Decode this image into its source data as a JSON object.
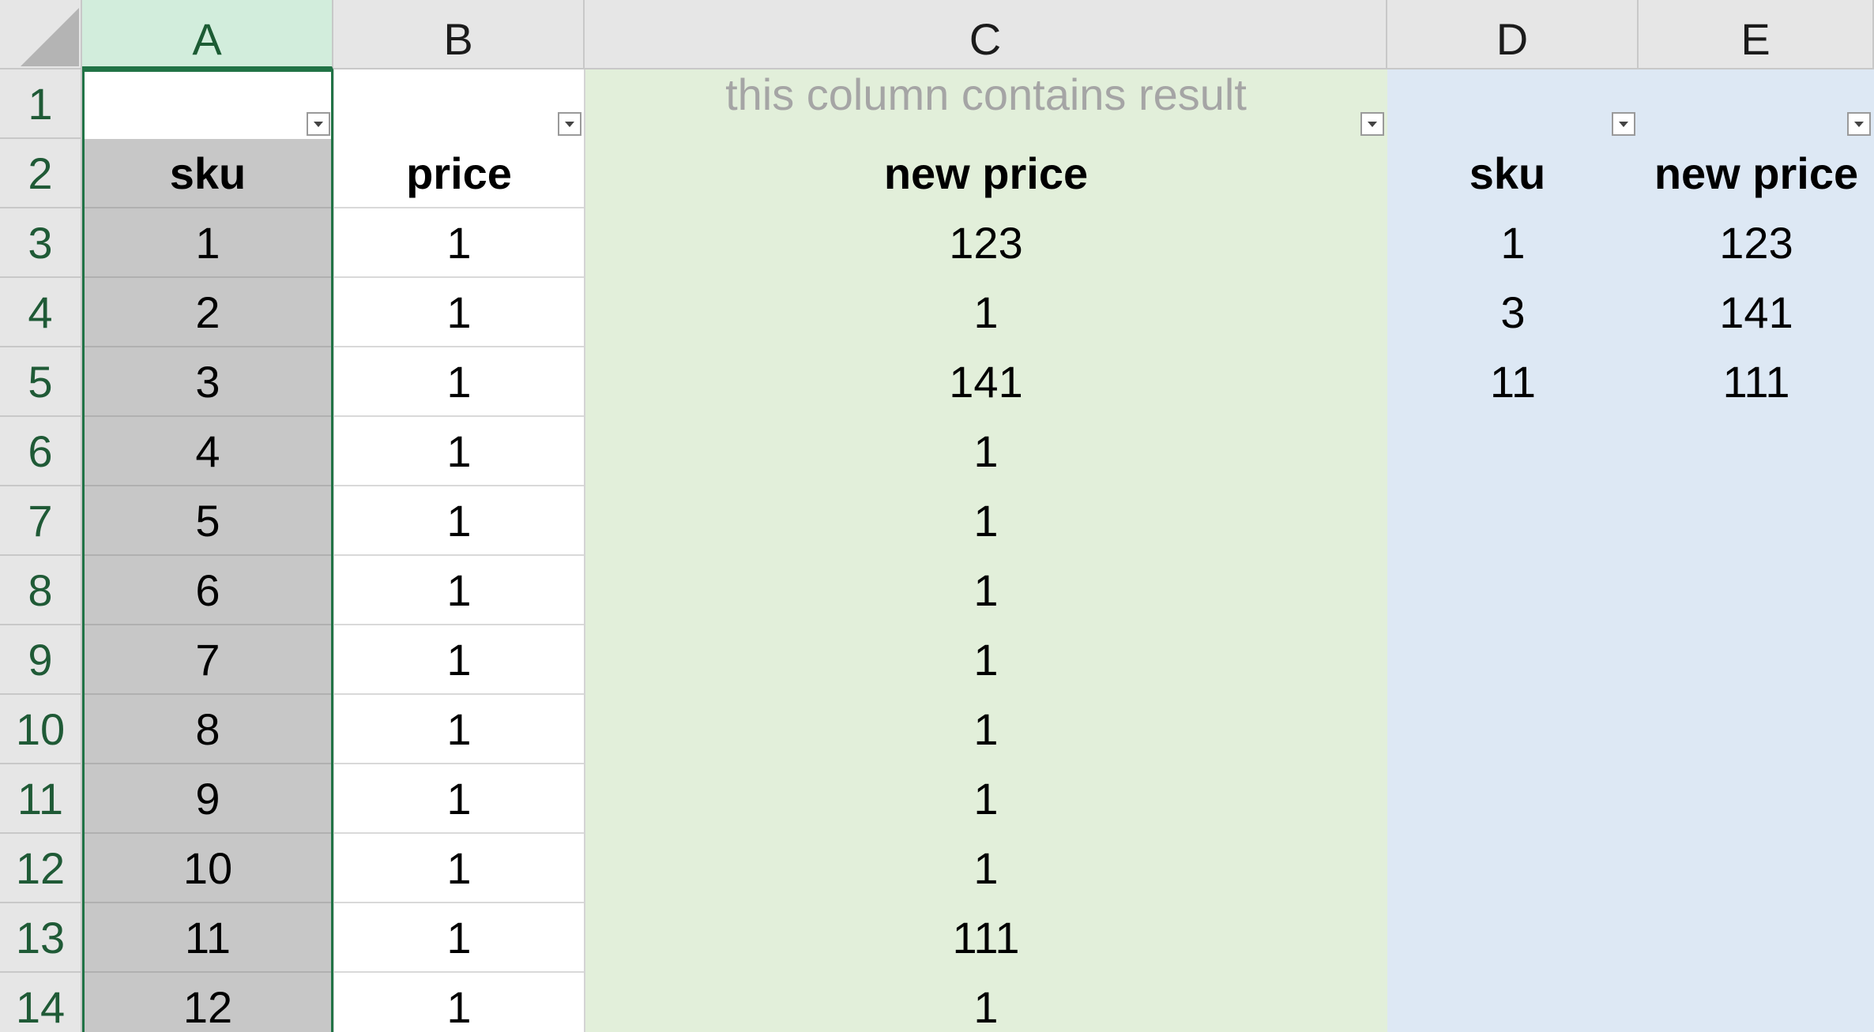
{
  "columns": [
    "A",
    "B",
    "C",
    "D",
    "E"
  ],
  "rows": [
    "1",
    "2",
    "3",
    "4",
    "5",
    "6",
    "7",
    "8",
    "9",
    "10",
    "11",
    "12",
    "13",
    "14"
  ],
  "row1": {
    "C": "this column contains result"
  },
  "headers": {
    "A": "sku",
    "B": "price",
    "C": "new price",
    "D": "sku",
    "E": "new price"
  },
  "data": [
    {
      "A": "1",
      "B": "1",
      "C": "123",
      "D": "1",
      "E": "123"
    },
    {
      "A": "2",
      "B": "1",
      "C": "1",
      "D": "3",
      "E": "141"
    },
    {
      "A": "3",
      "B": "1",
      "C": "141",
      "D": "11",
      "E": "111"
    },
    {
      "A": "4",
      "B": "1",
      "C": "1",
      "D": "",
      "E": ""
    },
    {
      "A": "5",
      "B": "1",
      "C": "1",
      "D": "",
      "E": ""
    },
    {
      "A": "6",
      "B": "1",
      "C": "1",
      "D": "",
      "E": ""
    },
    {
      "A": "7",
      "B": "1",
      "C": "1",
      "D": "",
      "E": ""
    },
    {
      "A": "8",
      "B": "1",
      "C": "1",
      "D": "",
      "E": ""
    },
    {
      "A": "9",
      "B": "1",
      "C": "1",
      "D": "",
      "E": ""
    },
    {
      "A": "10",
      "B": "1",
      "C": "1",
      "D": "",
      "E": ""
    },
    {
      "A": "11",
      "B": "1",
      "C": "111",
      "D": "",
      "E": ""
    },
    {
      "A": "12",
      "B": "1",
      "C": "1",
      "D": "",
      "E": ""
    }
  ],
  "colors": {
    "selected_header": "#d2eddc",
    "selection_border": "#217346",
    "result_column": "#e2efda",
    "lookup_table": "#dde8f4",
    "selected_column": "#c7c7c7"
  }
}
